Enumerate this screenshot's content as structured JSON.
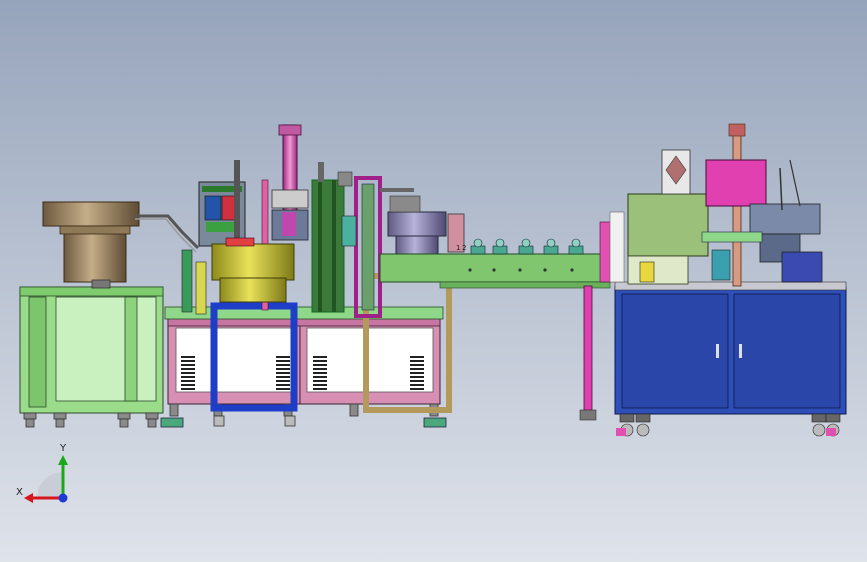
{
  "viewport": {
    "background_top": "#96a4bb",
    "background_bottom": "#dfe3ea"
  },
  "machine": {
    "fixture_labels": [
      "1",
      "2"
    ]
  },
  "triad": {
    "x_label": "X",
    "y_label": "Y",
    "x_color": "#d8141c",
    "y_color": "#1aa81a",
    "z_color": "#1f3ad6"
  },
  "palette": {
    "frame_green": "#9bdc8a",
    "pink_base": "#d88fb4",
    "cabinet_blue": "#2f4fb8",
    "bowl_gold": "#c9c23b",
    "bowl_brown": "#a08a6a",
    "bowl_purple": "#8a86b0",
    "conveyor_green": "#7fc66f",
    "magenta": "#e040b0",
    "olive_box": "#9bc07a"
  }
}
